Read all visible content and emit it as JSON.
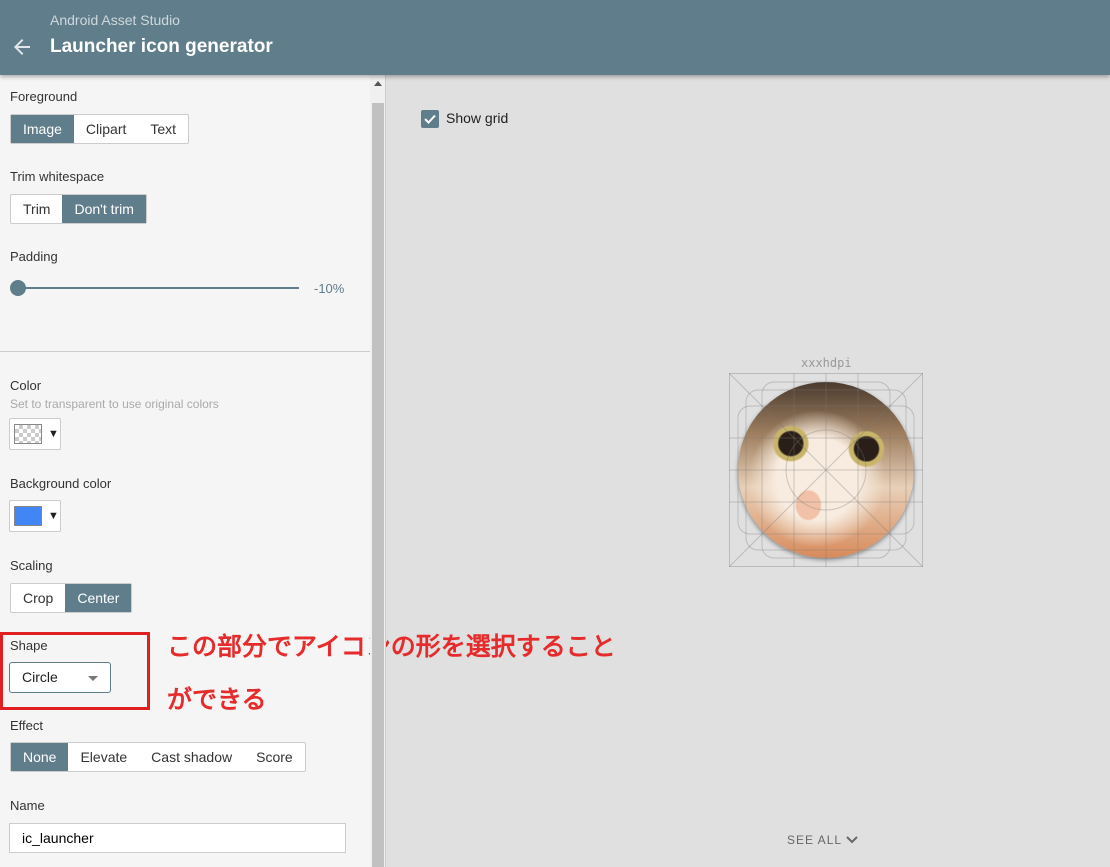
{
  "header": {
    "app": "Android Asset Studio",
    "title": "Launcher icon generator"
  },
  "foreground": {
    "label": "Foreground",
    "options": [
      "Image",
      "Clipart",
      "Text"
    ],
    "selected": "Image"
  },
  "trim": {
    "label": "Trim whitespace",
    "options": [
      "Trim",
      "Don't trim"
    ],
    "selected": "Don't trim"
  },
  "padding": {
    "label": "Padding",
    "value": "-10%"
  },
  "color": {
    "label": "Color",
    "hint": "Set to transparent to use original colors",
    "value": "transparent"
  },
  "bgcolor": {
    "label": "Background color",
    "value": "#4285f4"
  },
  "scaling": {
    "label": "Scaling",
    "options": [
      "Crop",
      "Center"
    ],
    "selected": "Center"
  },
  "shape": {
    "label": "Shape",
    "value": "Circle"
  },
  "effect": {
    "label": "Effect",
    "options": [
      "None",
      "Elevate",
      "Cast shadow",
      "Score"
    ],
    "selected": "None"
  },
  "name": {
    "label": "Name",
    "value": "ic_launcher"
  },
  "annotation": {
    "line1": "この部分でアイコンの形を選択すること",
    "line2": "ができる",
    "color": "#e52b2b"
  },
  "preview": {
    "show_grid": "Show grid",
    "density": "xxxhdpi",
    "see_all": "SEE ALL"
  }
}
